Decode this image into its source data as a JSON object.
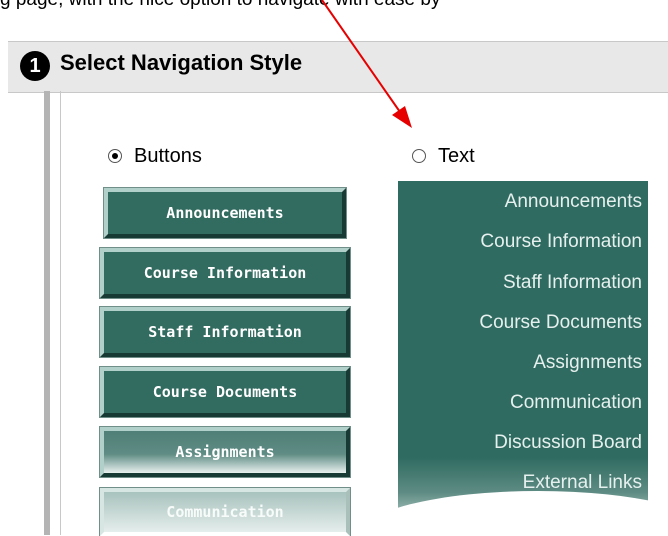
{
  "top_text": "g page, with the nice option to navigate with ease by",
  "section": {
    "step_number": "1",
    "title": "Select Navigation Style"
  },
  "options": {
    "buttons_label": "Buttons",
    "text_label": "Text",
    "selected": "Buttons"
  },
  "button_nav": {
    "items": [
      "Announcements",
      "Course Information",
      "Staff Information",
      "Course Documents",
      "Assignments",
      "Communication"
    ]
  },
  "text_nav": {
    "items": [
      "Announcements",
      "Course Information",
      "Staff Information",
      "Course Documents",
      "Assignments",
      "Communication",
      "Discussion Board",
      "External Links"
    ]
  },
  "colors": {
    "nav_green": "#326b60",
    "arrow_red": "#e60000"
  }
}
